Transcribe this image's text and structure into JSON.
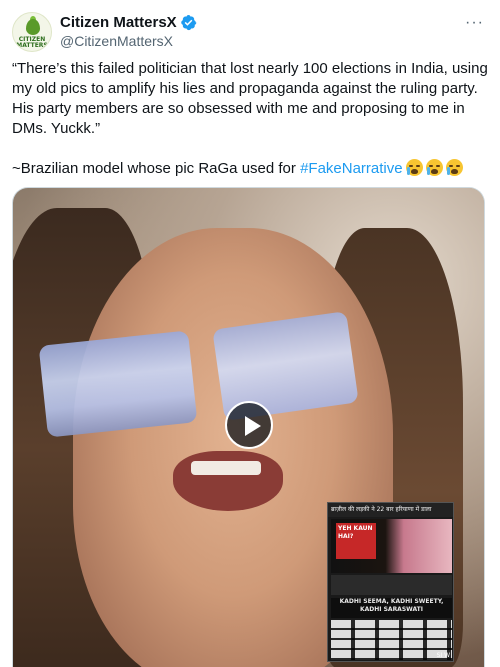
{
  "author": {
    "display_name": "Citizen MattersX",
    "handle": "@CitizenMattersX",
    "avatar_text": "CITIZEN MATTERS",
    "verified": true,
    "verified_color": "#1d9bf0"
  },
  "more_label": "···",
  "tweet": {
    "line1": "“There’s this failed politician that lost nearly 100 elections in India, using my old pics to amplify his lies and propaganda against the ruling party. His party members are so obsessed with me and proposing to me in DMs. Yuckk.”",
    "line2_prefix": "~Brazilian model whose pic RaGa used for ",
    "hashtag": "#FakeNarrative",
    "hashtag_color": "#1d9bf0",
    "emojis": [
      "loudly-crying-face",
      "loudly-crying-face",
      "loudly-crying-face"
    ]
  },
  "media": {
    "type": "video",
    "play_icon": "play-icon",
    "inset": {
      "header_text": "ब्राज़ील की लड़की ने 22 बार हरियाणा में डाला",
      "screen_text": "YEH KAUN HAI?",
      "banner_line1": "KADHI SEEMA, KADHI SWEETY,",
      "banner_line2": "KADHI SARASWATI",
      "corner_text": "SI W"
    }
  }
}
